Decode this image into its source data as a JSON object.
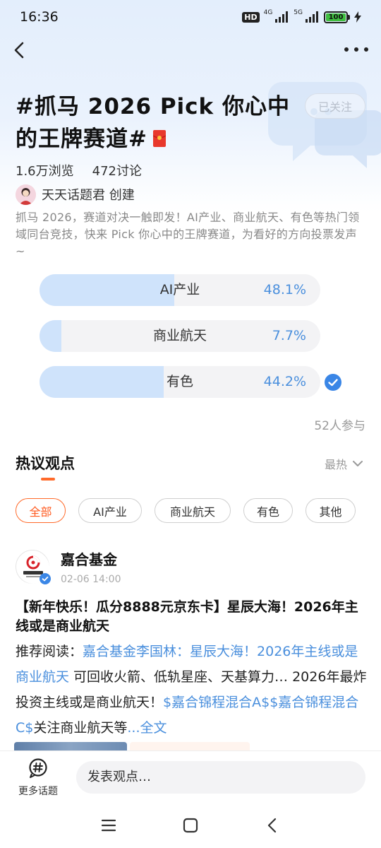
{
  "status_bar": {
    "time": "16:36",
    "hd": "HD",
    "net1": "4G",
    "net2": "5G",
    "battery": "100"
  },
  "nav": {
    "back_icon": "chevron-left-icon",
    "more_icon": "more-dots-icon"
  },
  "topic": {
    "title": "#抓马 2026  Pick 你心中的王牌赛道#",
    "follow_label": "已关注",
    "views": "1.6万浏览",
    "discussions": "472讨论",
    "creator": "天天话题君 创建",
    "description": "抓马 2026，赛道对决一触即发！AI产业、商业航天、有色等热门领域同台竞技，快来 Pick 你心中的王牌赛道，为看好的方向投票发声~"
  },
  "poll": {
    "options": [
      {
        "label": "AI产业",
        "percent_text": "48.1%",
        "value": 48.1
      },
      {
        "label": "商业航天",
        "percent_text": "7.7%",
        "value": 7.7
      },
      {
        "label": "有色",
        "percent_text": "44.2%",
        "value": 44.2,
        "selected": true
      }
    ],
    "participants": "52人参与"
  },
  "discussion": {
    "section_title": "热议观点",
    "sort_label": "最热",
    "filters": [
      "全部",
      "AI产业",
      "商业航天",
      "有色",
      "其他"
    ]
  },
  "post": {
    "author": "嘉合基金",
    "time": "02-06 14:00",
    "heading": "【新年快乐！瓜分8888元京东卡】星辰大海！2026年主线或是商业航天",
    "body_prefix": "推荐阅读：",
    "body_link": "嘉合基金李国林：星辰大海！2026年主线或是商业航天",
    "body_text": " 可回收火箭、低轨星座、天基算力… 2026年最炸投资主线或是商业航天！",
    "body_stock1": "$嘉合锦程混合A$",
    "body_stock2": "$嘉合锦程混合C$",
    "body_text2": "关注商业航天等",
    "body_more": "...全文"
  },
  "bottom_bar": {
    "more_topics_label": "更多话题",
    "comment_placeholder": "发表观点…"
  },
  "colors": {
    "accent": "#ff6a2a",
    "link": "#4a8fdd",
    "poll_fill": "#cfe3fb"
  }
}
